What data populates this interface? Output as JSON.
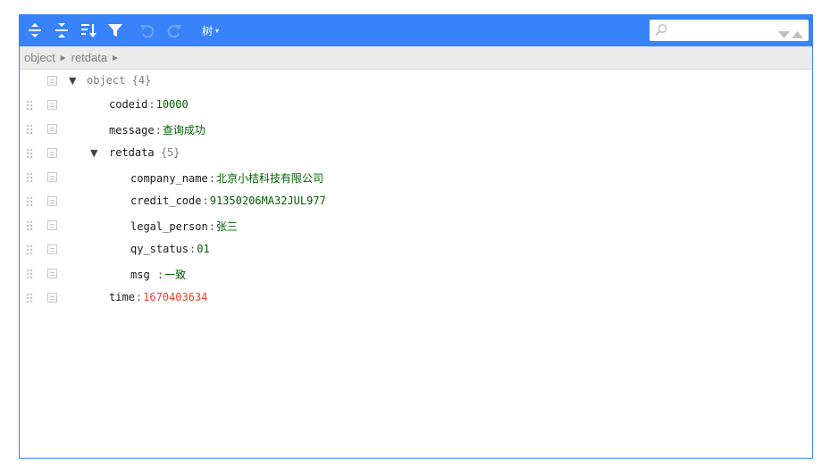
{
  "toolbar": {
    "mode_label": "树",
    "mode_caret": "▾",
    "search_placeholder": ""
  },
  "colors": {
    "accent": "#3883fa",
    "value_green": "#006000",
    "value_red": "#ee422e"
  },
  "navbar": {
    "crumbs": [
      "object",
      "retdata"
    ],
    "separator": "►"
  },
  "tree": {
    "root": {
      "toggle": "▼",
      "label": "object",
      "count": "{4}"
    },
    "codeid": {
      "key": "codeid",
      "value": "10000"
    },
    "message": {
      "key": "message",
      "value": "查询成功"
    },
    "retdata": {
      "toggle": "▼",
      "label": "retdata",
      "count": "{5}"
    },
    "company_name": {
      "key": "company_name",
      "value": "北京小桔科技有限公司"
    },
    "credit_code": {
      "key": "credit_code",
      "value": "91350206MA32JUL977"
    },
    "legal_person": {
      "key": "legal_person",
      "value": "张三"
    },
    "qy_status": {
      "key": "qy_status",
      "value": "01"
    },
    "msg": {
      "key": "msg ",
      "value": "一致"
    },
    "time": {
      "key": "time",
      "value": "1670403634"
    },
    "colon": ":"
  }
}
